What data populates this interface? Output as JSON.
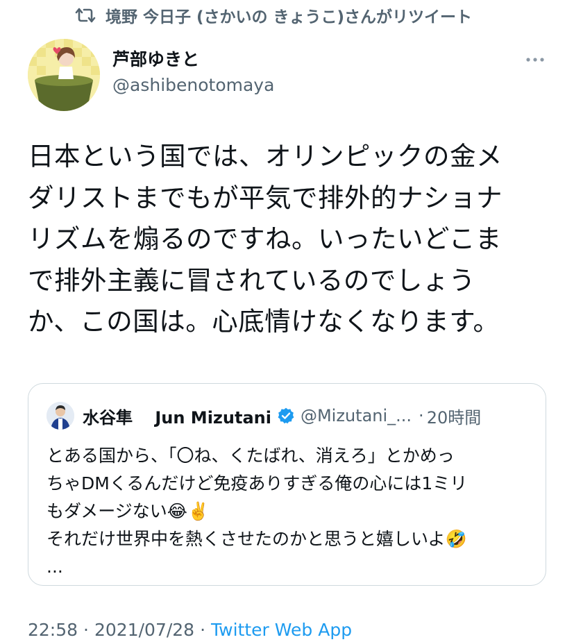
{
  "retweet": {
    "text": "境野 今日子 (さかいの きょうこ)さんがリツイート"
  },
  "author": {
    "display_name": "芦部ゆきと",
    "handle": "@ashibenotomaya"
  },
  "tweet": {
    "text": "日本という国では、オリンピックの金メ\nダリストまでもが平気で排外的ナショナ\nリズムを煽るのですね。いったいどこま\nで排外主義に冒されているのでしょう\nか、この国は。心底情けなくなります。"
  },
  "quote": {
    "display_name": "水谷隼　 Jun Mizutani",
    "handle": "@Mizutani_...",
    "dot": "·",
    "time": "20時間",
    "text": "とある国から、「〇ね、くたばれ、消えろ」とかめっ\nちゃDMくるんだけど免疫ありすぎる俺の心には1ミリ\nもダメージない😂✌️\nそれだけ世界中を熱くさせたのかと思うと嬉しいよ🤣\n..."
  },
  "footer": {
    "time": "22:58",
    "sep1": "·",
    "date": "2021/07/28",
    "sep2": "·",
    "app": "Twitter Web App"
  },
  "colors": {
    "primary_text": "#0f1419",
    "secondary_text": "#536471",
    "link": "#1d9bf0",
    "verified": "#1d9bf0",
    "border": "#cfd9de"
  }
}
